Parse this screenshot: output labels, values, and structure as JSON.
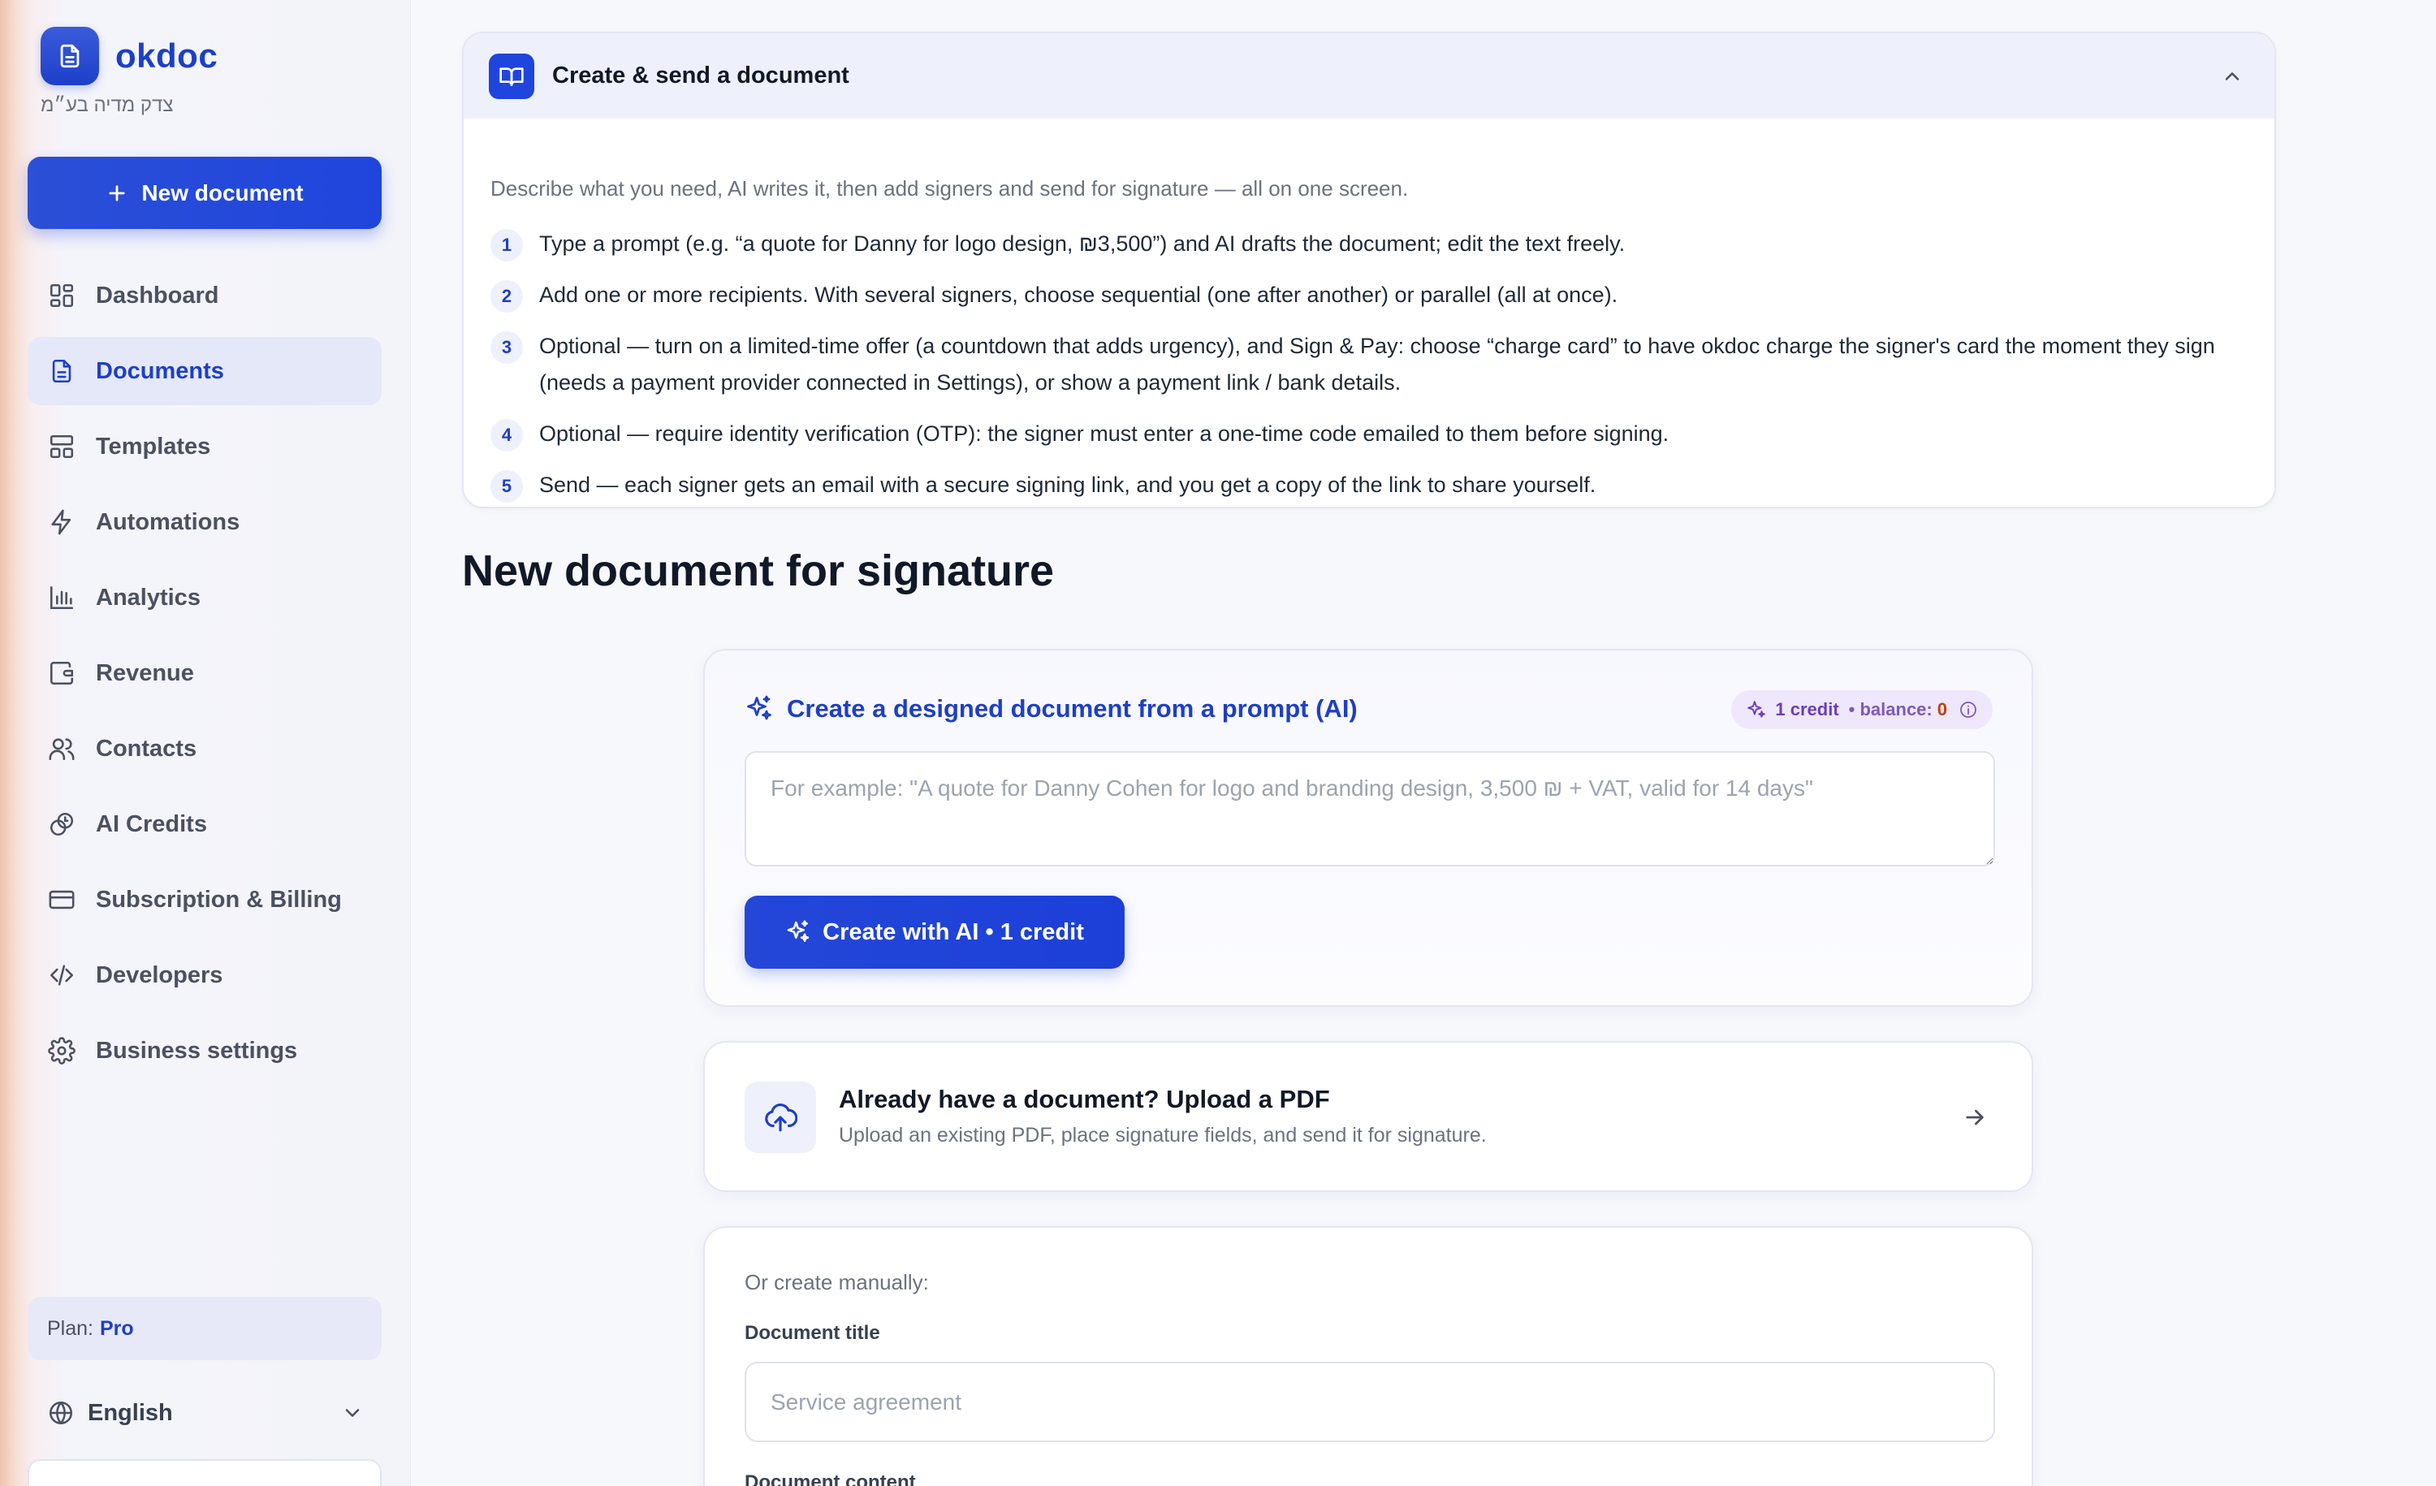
{
  "app": {
    "name": "okdoc",
    "business_name": "צדק מדיה בע״מ"
  },
  "sidebar": {
    "new_document_label": "New document",
    "items": [
      {
        "label": "Dashboard",
        "icon": "dashboard-icon",
        "active": false
      },
      {
        "label": "Documents",
        "icon": "document-icon",
        "active": true
      },
      {
        "label": "Templates",
        "icon": "templates-icon",
        "active": false
      },
      {
        "label": "Automations",
        "icon": "lightning-icon",
        "active": false
      },
      {
        "label": "Analytics",
        "icon": "bar-chart-icon",
        "active": false
      },
      {
        "label": "Revenue",
        "icon": "wallet-icon",
        "active": false
      },
      {
        "label": "Contacts",
        "icon": "users-icon",
        "active": false
      },
      {
        "label": "AI Credits",
        "icon": "credits-icon",
        "active": false
      },
      {
        "label": "Subscription & Billing",
        "icon": "credit-card-icon",
        "active": false
      },
      {
        "label": "Developers",
        "icon": "code-icon",
        "active": false
      },
      {
        "label": "Business settings",
        "icon": "gear-icon",
        "active": false
      }
    ],
    "plan_label": "Plan:",
    "plan_value": "Pro",
    "language": "English"
  },
  "guide": {
    "title": "Create & send a document",
    "description": "Describe what you need, AI writes it, then add signers and send for signature — all on one screen.",
    "steps": [
      {
        "num": "1",
        "text": "Type a prompt (e.g. “a quote for Danny for logo design, ₪3,500”) and AI drafts the document; edit the text freely."
      },
      {
        "num": "2",
        "text": "Add one or more recipients. With several signers, choose sequential (one after another) or parallel (all at once)."
      },
      {
        "num": "3",
        "text": "Optional — turn on a limited-time offer (a countdown that adds urgency), and Sign & Pay: choose “charge card” to have okdoc charge the signer's card the moment they sign (needs a payment provider connected in Settings), or show a payment link / bank details."
      },
      {
        "num": "4",
        "text": "Optional — require identity verification (OTP): the signer must enter a one-time code emailed to them before signing."
      },
      {
        "num": "5",
        "text": "Send — each signer gets an email with a secure signing link, and you get a copy of the link to share yourself."
      }
    ]
  },
  "page": {
    "title": "New document for signature"
  },
  "ai_card": {
    "title": "Create a designed document from a prompt (AI)",
    "credit_amount": "1 credit",
    "balance_label": "• balance:",
    "balance_value": "0",
    "prompt_placeholder": "For example: \"A quote for Danny Cohen for logo and branding design, 3,500 ₪ + VAT, valid for 14 days\"",
    "prompt_value": "",
    "button_label": "Create with AI • 1 credit"
  },
  "upload_card": {
    "title": "Already have a document? Upload a PDF",
    "subtitle": "Upload an existing PDF, place signature fields, and send it for signature."
  },
  "manual_card": {
    "intro": "Or create manually:",
    "title_label": "Document title",
    "title_placeholder": "Service agreement",
    "title_value": "",
    "content_label": "Document content"
  },
  "colors": {
    "accent": "#1f45dd",
    "accent_text": "#1f3fc4",
    "credit_pill_bg": "#efe7fb",
    "balance_zero": "#c2410c"
  }
}
